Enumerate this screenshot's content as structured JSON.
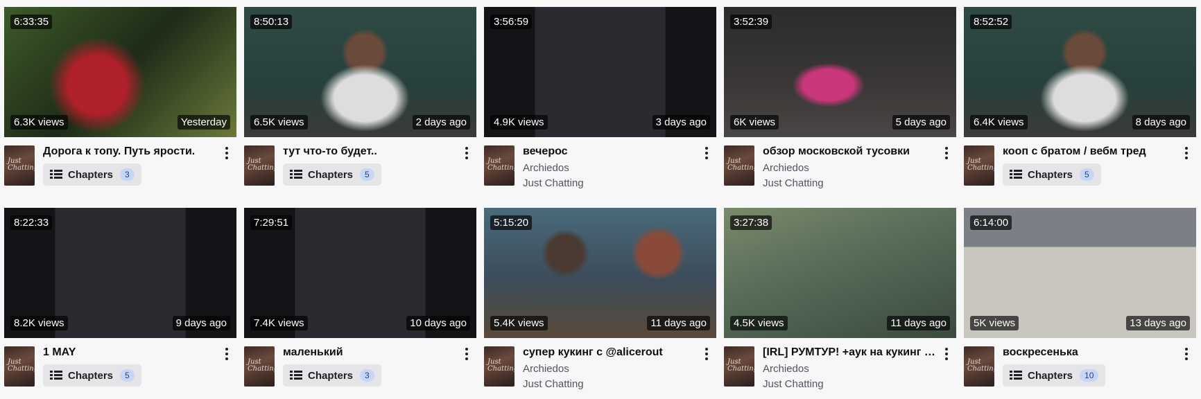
{
  "videos": [
    {
      "duration": "6:33:35",
      "views": "6.3K views",
      "date": "Yesterday",
      "title": "Дорога к топу. Путь ярости.",
      "chapters_label": "Chapters",
      "chapters_count": "3",
      "channel": "",
      "category": "",
      "selected": false,
      "palette": "green"
    },
    {
      "duration": "8:50:13",
      "views": "6.5K views",
      "date": "2 days ago",
      "title": "тут что-то будет..",
      "chapters_label": "Chapters",
      "chapters_count": "5",
      "channel": "",
      "category": "",
      "selected": false,
      "palette": "room"
    },
    {
      "duration": "3:56:59",
      "views": "4.9K views",
      "date": "3 days ago",
      "title": "вечерос",
      "chapters_label": "",
      "chapters_count": "",
      "channel": "Archiedos",
      "category": "Just Chatting",
      "selected": true,
      "palette": "dark"
    },
    {
      "duration": "3:52:39",
      "views": "6K views",
      "date": "5 days ago",
      "title": "обзор московской тусовки",
      "chapters_label": "",
      "chapters_count": "",
      "channel": "Archiedos",
      "category": "Just Chatting",
      "selected": false,
      "palette": "party"
    },
    {
      "duration": "8:52:52",
      "views": "6.4K views",
      "date": "8 days ago",
      "title": "кооп с братом / вебм тред",
      "chapters_label": "Chapters",
      "chapters_count": "5",
      "channel": "",
      "category": "",
      "selected": false,
      "palette": "room"
    },
    {
      "duration": "8:22:33",
      "views": "8.2K views",
      "date": "9 days ago",
      "title": "1 MAY",
      "chapters_label": "Chapters",
      "chapters_count": "5",
      "channel": "",
      "category": "",
      "selected": false,
      "palette": "dark"
    },
    {
      "duration": "7:29:51",
      "views": "7.4K views",
      "date": "10 days ago",
      "title": "маленький",
      "chapters_label": "Chapters",
      "chapters_count": "3",
      "channel": "",
      "category": "",
      "selected": false,
      "palette": "dark"
    },
    {
      "duration": "5:15:20",
      "views": "5.4K views",
      "date": "11 days ago",
      "title": "супер кукинг с @alicerout",
      "chapters_label": "",
      "chapters_count": "",
      "channel": "Archiedos",
      "category": "Just Chatting",
      "selected": false,
      "palette": "kitchen"
    },
    {
      "duration": "3:27:38",
      "views": "4.5K views",
      "date": "11 days ago",
      "title": "[IRL] РУМТУР! +аук на кукинг f...",
      "chapters_label": "",
      "chapters_count": "",
      "channel": "Archiedos",
      "category": "Just Chatting",
      "selected": false,
      "palette": "blur"
    },
    {
      "duration": "6:14:00",
      "views": "5K views",
      "date": "13 days ago",
      "title": "воскресенька",
      "chapters_label": "Chapters",
      "chapters_count": "10",
      "channel": "",
      "category": "",
      "selected": false,
      "palette": "snow"
    }
  ],
  "avatar_text": "Just Chatting",
  "colors": {
    "accent": "#e91916",
    "chapter_badge": "#c7d6f7",
    "background": "#f7f7f8"
  }
}
